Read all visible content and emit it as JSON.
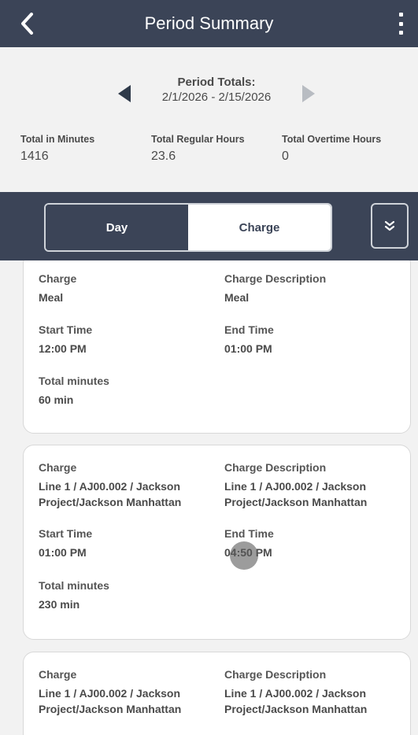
{
  "header": {
    "title": "Period Summary"
  },
  "period": {
    "label": "Period Totals:",
    "range": "2/1/2026 - 2/15/2026"
  },
  "totals": [
    {
      "label": "Total in Minutes",
      "value": "1416"
    },
    {
      "label": "Total Regular Hours",
      "value": "23.6"
    },
    {
      "label": "Total Overtime Hours",
      "value": "0"
    }
  ],
  "toggle": {
    "day_label": "Day",
    "charge_label": "Charge"
  },
  "cards": [
    {
      "charge_label": "Charge",
      "charge_value": "Meal",
      "desc_label": "Charge Description",
      "desc_value": "Meal",
      "start_label": "Start Time",
      "start_value": "12:00 PM",
      "end_label": "End Time",
      "end_value": "01:00 PM",
      "minutes_label": "Total minutes",
      "minutes_value": "60 min"
    },
    {
      "charge_label": "Charge",
      "charge_value_line1": "Line 1 / AJ00.002 / Jackson",
      "charge_value_line2": "Project/Jackson Manhattan",
      "desc_label": "Charge Description",
      "desc_value_line1": "Line 1 / AJ00.002 / Jackson",
      "desc_value_line2": "Project/Jackson Manhattan",
      "start_label": "Start Time",
      "start_value": "01:00 PM",
      "end_label": "End Time",
      "end_value": "04:50 PM",
      "minutes_label": "Total minutes",
      "minutes_value": "230 min"
    },
    {
      "charge_label": "Charge",
      "charge_value_line1": "Line 1 / AJ00.002 / Jackson",
      "charge_value_line2": "Project/Jackson Manhattan",
      "desc_label": "Charge Description",
      "desc_value_line1": "Line 1 / AJ00.002 / Jackson",
      "desc_value_line2": "Project/Jackson Manhattan"
    }
  ],
  "colors": {
    "header_bg": "#3b4457",
    "page_bg": "#f2f2f2",
    "card_bg": "#ffffff"
  },
  "icons": [
    "back-chevron-icon",
    "kebab-menu-icon",
    "arrow-left-icon",
    "arrow-right-icon",
    "double-chevron-down-icon"
  ]
}
